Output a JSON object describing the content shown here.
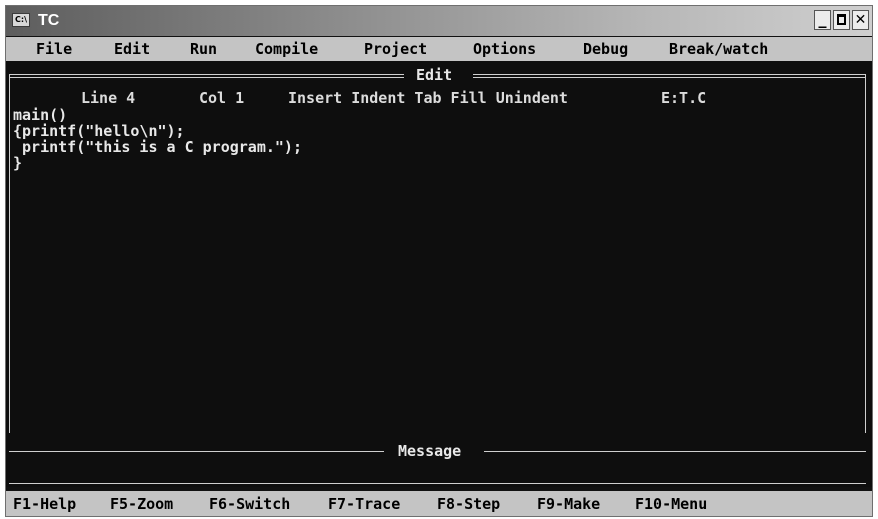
{
  "window": {
    "title": "TC",
    "icon": "console-icon"
  },
  "menu": [
    "File",
    "Edit",
    "Run",
    "Compile",
    "Project",
    "Options",
    "Debug",
    "Break/watch"
  ],
  "editor": {
    "title": "Edit",
    "status": {
      "line": "Line 4",
      "col": "Col 1",
      "modes": "Insert Indent Tab Fill Unindent",
      "file": "E:T.C"
    },
    "code": [
      "main()",
      "{printf(\"hello\\n\");",
      " printf(\"this is a C program.\");",
      "}"
    ]
  },
  "message": {
    "title": "Message"
  },
  "function_keys": [
    "F1-Help",
    "F5-Zoom",
    "F6-Switch",
    "F7-Trace",
    "F8-Step",
    "F9-Make",
    "F10-Menu"
  ]
}
